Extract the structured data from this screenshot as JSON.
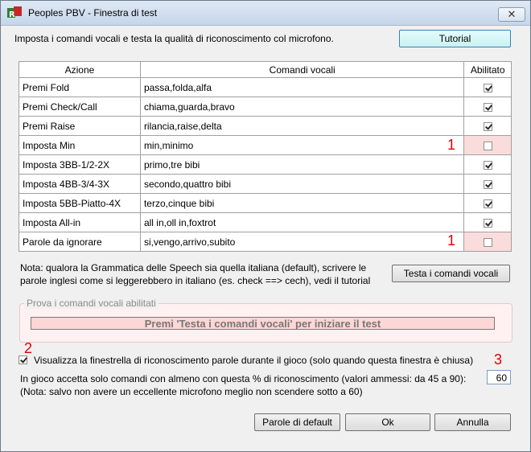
{
  "window": {
    "title": "Peoples PBV - Finestra di test",
    "close_symbol": "✕"
  },
  "intro": "Imposta i comandi vocali e testa la qualità di riconoscimento col microfono.",
  "tutorial_button": "Tutorial",
  "table": {
    "headers": {
      "action": "Azione",
      "commands": "Comandi vocali",
      "enabled": "Abilitato"
    },
    "rows": [
      {
        "action": "Premi Fold",
        "commands": "passa,folda,alfa",
        "enabled": true
      },
      {
        "action": "Premi Check/Call",
        "commands": "chiama,guarda,bravo",
        "enabled": true
      },
      {
        "action": "Premi Raise",
        "commands": "rilancia,raise,delta",
        "enabled": true
      },
      {
        "action": "Imposta Min",
        "commands": "min,minimo",
        "enabled": false,
        "marker": "1"
      },
      {
        "action": "Imposta 3BB-1/2-2X",
        "commands": "primo,tre bibi",
        "enabled": true
      },
      {
        "action": "Imposta 4BB-3/4-3X",
        "commands": "secondo,quattro bibi",
        "enabled": true
      },
      {
        "action": "Imposta 5BB-Piatto-4X",
        "commands": "terzo,cinque bibi",
        "enabled": true
      },
      {
        "action": "Imposta All-in",
        "commands": "all in,oll in,foxtrot",
        "enabled": true
      },
      {
        "action": "Parole da ignorare",
        "commands": "si,vengo,arrivo,subito",
        "enabled": false,
        "marker": "1"
      }
    ]
  },
  "note": {
    "line1": "Nota: qualora la Grammatica delle Speech sia  quella italiana (default),  scrivere le",
    "line2": "parole inglesi come si leggerebbero in italiano (es. check ==> cech), vedi il tutorial"
  },
  "test_button": "Testa i comandi vocali",
  "test_group": {
    "legend": "Prova i comandi vocali abilitati",
    "prompt": "Premi 'Testa i comandi vocali' per iniziare il test"
  },
  "show_window": {
    "marker": "2",
    "checked": true,
    "label": "Visualizza la finestrella di riconoscimento parole durante il gioco (solo quando questa finestra è chiusa)",
    "marker_right": "3"
  },
  "accept": {
    "line1": "In gioco accetta solo comandi con almeno con questa % di riconoscimento (valori ammessi: da 45 a 90):",
    "line2": "(Nota: salvo non avere un eccellente microfono meglio non scendere sotto a 60)",
    "value": "60"
  },
  "buttons": {
    "default": "Parole di default",
    "ok": "Ok",
    "cancel": "Annulla"
  },
  "colors": {
    "disabled_row": "#fadcdc",
    "marker": "#e00000",
    "tutorial_bg": "#c9f2f3"
  }
}
